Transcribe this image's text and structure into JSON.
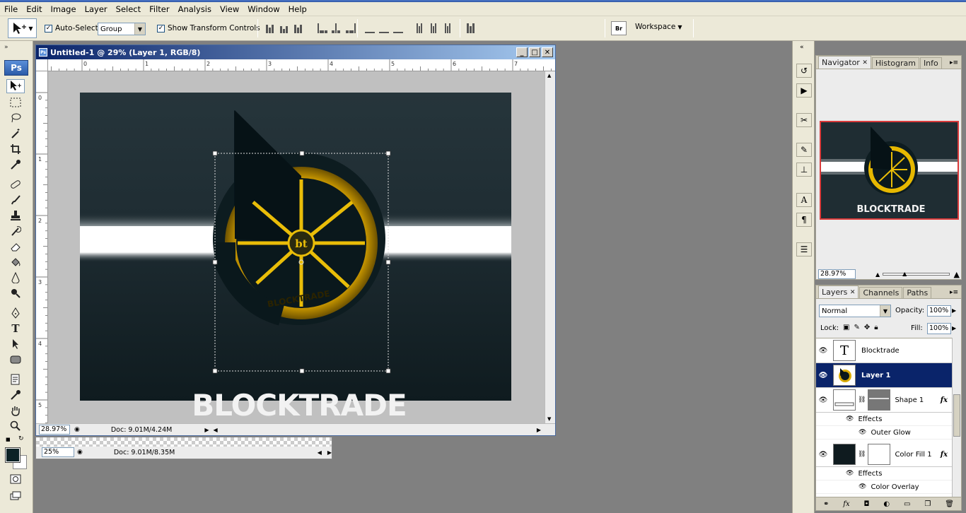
{
  "menu": [
    "File",
    "Edit",
    "Image",
    "Layer",
    "Select",
    "Filter",
    "Analysis",
    "View",
    "Window",
    "Help"
  ],
  "options": {
    "auto_select_label": "Auto-Select:",
    "auto_select_value": "Group",
    "show_transform_label": "Show Transform Controls",
    "workspace_label": "Workspace"
  },
  "tools": {
    "logo": "Ps"
  },
  "doc1": {
    "title": "Untitled-1 @ 29% (Layer 1, RGB/8)",
    "zoom": "28.97%",
    "doc_info": "Doc: 9.01M/4.24M",
    "ruler_h": [
      "0",
      "1",
      "2",
      "3",
      "4",
      "5",
      "6",
      "7"
    ],
    "ruler_v": [
      "0",
      "1",
      "2",
      "3",
      "4",
      "5"
    ],
    "logo_text": "BLOCKTRADE",
    "ring_text": "BLOCKTRADE",
    "center_text": "bt"
  },
  "doc2": {
    "zoom": "25%",
    "doc_info": "Doc: 9.01M/8.35M"
  },
  "navigator": {
    "tabs": [
      "Navigator",
      "Histogram",
      "Info"
    ],
    "zoom": "28.97%",
    "preview_text": "BLOCKTRADE"
  },
  "layers": {
    "tabs": [
      "Layers",
      "Channels",
      "Paths"
    ],
    "blend_mode": "Normal",
    "opacity_label": "Opacity:",
    "opacity": "100%",
    "lock_label": "Lock:",
    "fill_label": "Fill:",
    "fill": "100%",
    "rows": [
      {
        "name": "Blocktrade",
        "type": "text",
        "thumb": "T"
      },
      {
        "name": "Layer 1",
        "type": "image",
        "selected": true
      },
      {
        "name": "Shape 1",
        "type": "shape",
        "fx": "fx",
        "effects_label": "Effects",
        "effect": "Outer Glow"
      },
      {
        "name": "Color Fill 1",
        "type": "fill",
        "fx": "fx",
        "effects_label": "Effects",
        "effect": "Color Overlay"
      }
    ]
  },
  "colors": {
    "accent": "#0a246a",
    "canvas_bg": "#1c2a30",
    "gold": "#e0b400"
  }
}
